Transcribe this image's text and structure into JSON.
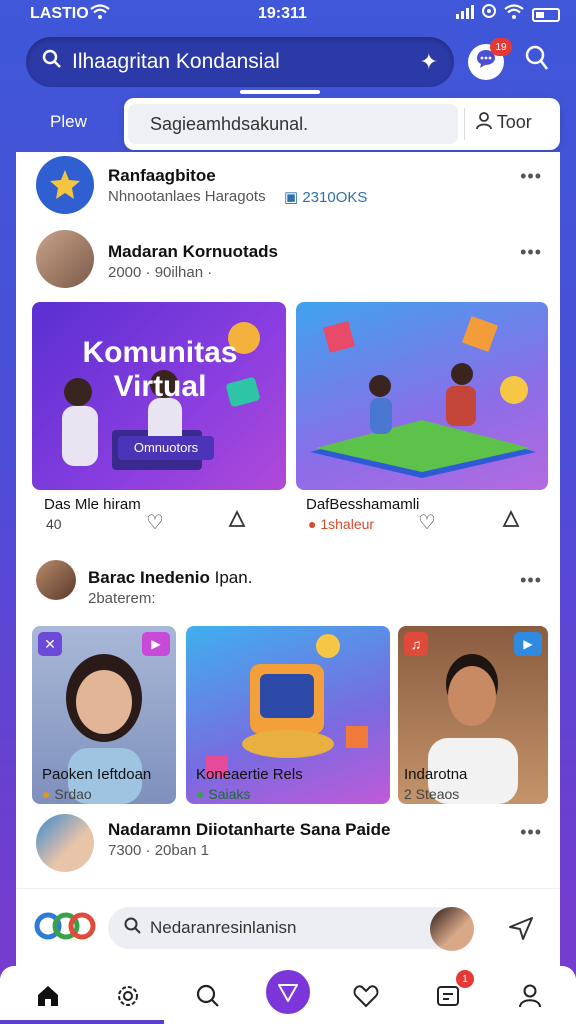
{
  "status": {
    "carrier": "LASTIO",
    "time": "19:311"
  },
  "header": {
    "search_text": "Ilhaagritan Kondansial",
    "chat_badge": "19"
  },
  "tabs": {
    "view_label": "Plew",
    "input_text": "Sagieamhdsakunal.",
    "tour_label": "Toor"
  },
  "posts": [
    {
      "name": "Ranfaagbitoe",
      "meta": "Nhnootanlaes Haragots",
      "stat": "2310OKS"
    },
    {
      "name": "Madaran Kornuotads",
      "meta": "2000 · 90ilhan ·"
    },
    {
      "name": "Barac Inedenio",
      "name_suffix": "Ipan.",
      "meta": "2baterem:"
    },
    {
      "name": "Nadaramn Diiotanharte Sana Paide",
      "meta": "7300 · 20ban 1"
    }
  ],
  "tiles_row1": [
    {
      "overlay_title": "Komunitas Virtual",
      "overlay_button": "Omnuotors",
      "caption": "Das Mle hiram",
      "sub": "40"
    },
    {
      "caption": "DafBesshamamli",
      "sub": "1shaleur"
    }
  ],
  "tiles_row2": [
    {
      "caption": "Paoken Ieftdoan",
      "sub": "Srdao"
    },
    {
      "caption": "Koneaertie Rels",
      "sub": "Saiaks"
    },
    {
      "caption": "Indarotna",
      "sub": "2 Steaos"
    }
  ],
  "comment": {
    "placeholder": "Nedaranresinlanisn"
  },
  "nav": {
    "badge": "1"
  },
  "colors": {
    "accent": "#4a4fd6",
    "purple": "#7b35d8",
    "badge": "#e53935"
  }
}
